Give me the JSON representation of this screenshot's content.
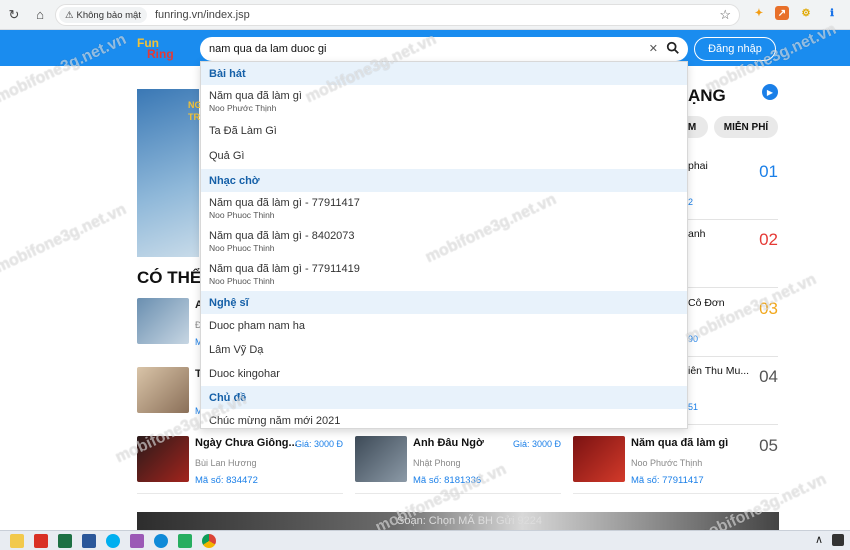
{
  "browser": {
    "security_label": "Không bảo mật",
    "url": "funring.vn/index.jsp"
  },
  "header": {
    "logo_top": "Fun",
    "logo_bottom": "Ring",
    "search_value": "nam qua da lam duoc gi",
    "login_label": "Đăng nhập"
  },
  "dropdown": {
    "groups": [
      {
        "title": "Bài hát",
        "items": [
          {
            "label": "Năm qua đã làm gì",
            "sub": "Noo Phước Thịnh"
          },
          {
            "label": "Ta Đã Làm Gì",
            "sub": ""
          },
          {
            "label": "Quả Gì",
            "sub": ""
          }
        ]
      },
      {
        "title": "Nhạc chờ",
        "items": [
          {
            "label": "Năm qua đã làm gì - 77911417",
            "sub": "Noo Phuoc Thinh"
          },
          {
            "label": "Năm qua đã làm gì - 8402073",
            "sub": "Noo Phuoc Thinh"
          },
          {
            "label": "Năm qua đã làm gì - 77911419",
            "sub": "Noo Phuoc Thinh"
          }
        ]
      },
      {
        "title": "Nghệ sĩ",
        "items": [
          {
            "label": "Duoc pham nam ha",
            "sub": ""
          },
          {
            "label": "Lâm Vỹ Dạ",
            "sub": ""
          },
          {
            "label": "Duoc kingohar",
            "sub": ""
          }
        ]
      },
      {
        "title": "Chủ đề",
        "items": [
          {
            "label": "Chúc mừng năm mới 2021",
            "sub": ""
          }
        ]
      }
    ]
  },
  "main": {
    "section_title": "CÓ THỂ",
    "rank_title": "ẠNG",
    "tab_left": "M",
    "tab_free": "MIỄN PHÍ",
    "banner_text": "NG\nTR",
    "left_cards": [
      {
        "letter": "A",
        "sub": "Đ",
        "code": "Mã"
      },
      {
        "letter": "T",
        "sub": "",
        "code": "Mã"
      }
    ],
    "cards": [
      {
        "title": "Ngày Chưa Giông...",
        "price": "Giá: 3000 Đ",
        "singer": "Bùi Lan Hương",
        "code": "Mã số: 834472"
      },
      {
        "title": "Anh Đâu Ngờ",
        "price": "Giá: 3000 Đ",
        "singer": "Nhật Phong",
        "code": "Mã số: 8181336"
      },
      {
        "title": "Năm qua đã làm gì",
        "price": "",
        "singer": "Noo Phước Thịnh",
        "code": "Mã số: 77911417"
      }
    ],
    "rank_rows": [
      {
        "song": "phai",
        "code": "2",
        "num": "01",
        "color": "#1a7fe8"
      },
      {
        "song": "anh",
        "code": "",
        "num": "02",
        "color": "#e53935"
      },
      {
        "song": "Cô Đơn",
        "code": "90",
        "num": "03",
        "color": "#f2a81d"
      },
      {
        "song": "iên Thu Mu...",
        "code": "51",
        "num": "04",
        "color": "#555555"
      },
      {
        "song": "",
        "code": "",
        "num": "05",
        "color": "#555555"
      }
    ],
    "bottom_banner_text": "Soạn: Chọn MÃ BH Gửi 9224"
  },
  "watermark": "mobifone3g.net.vn"
}
